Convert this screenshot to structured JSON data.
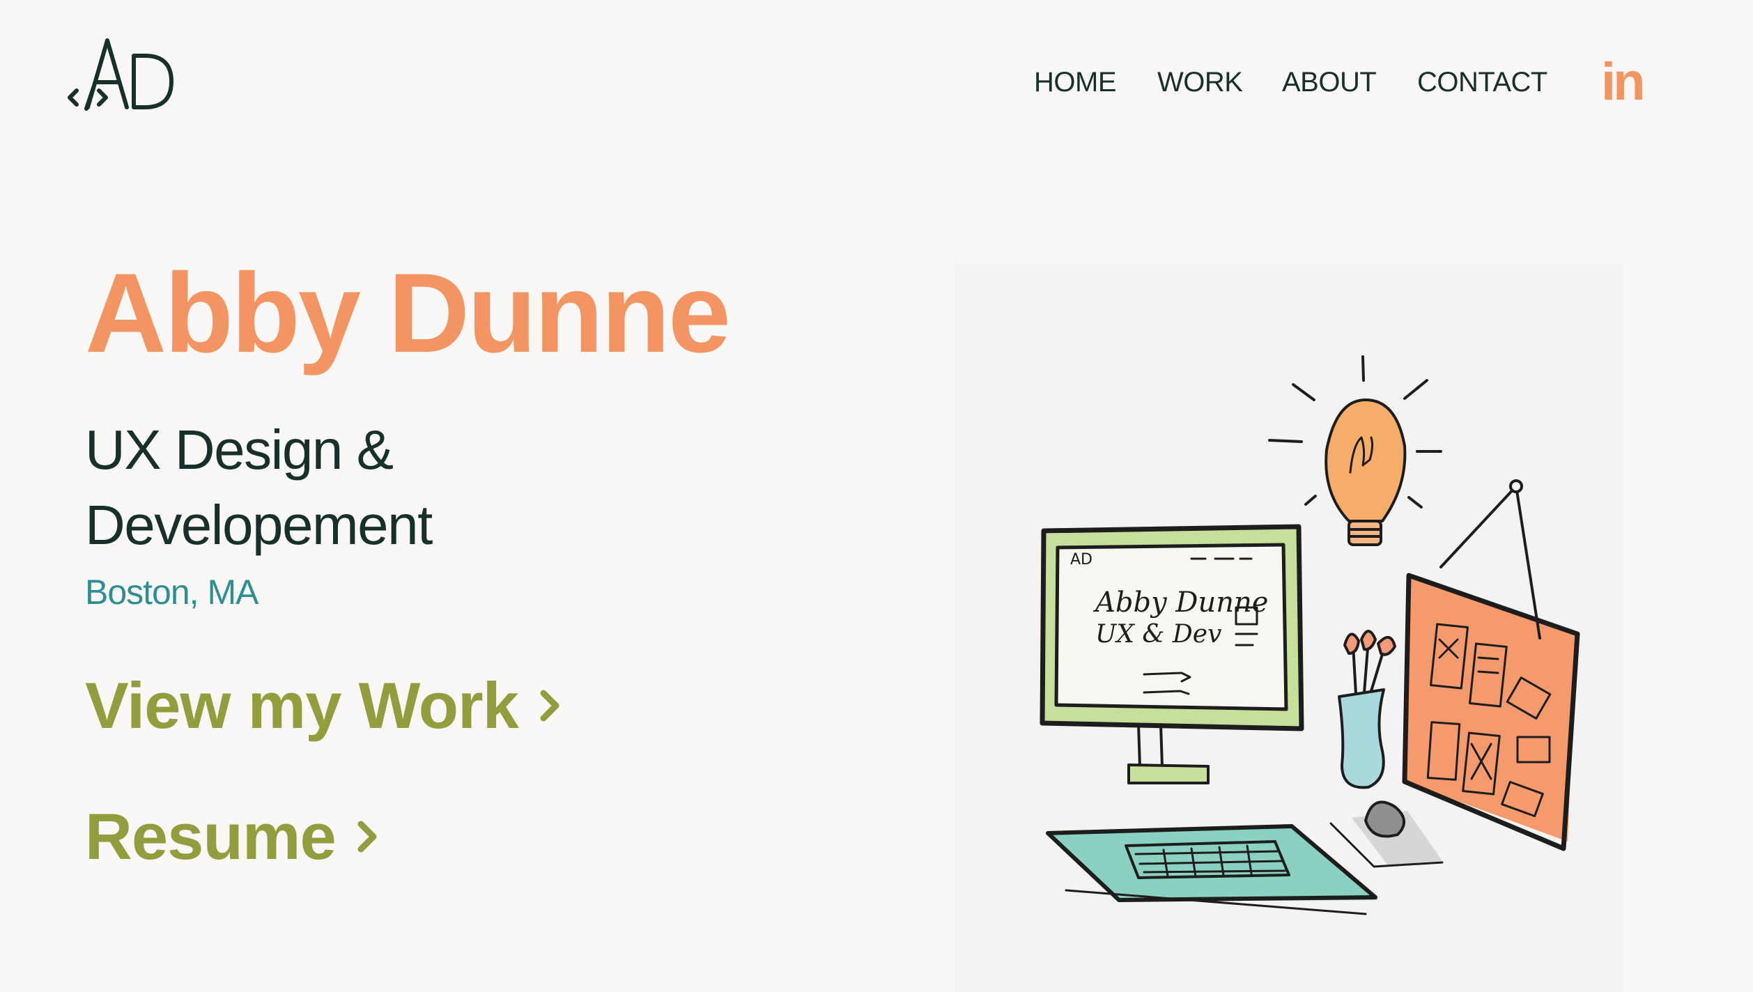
{
  "brand": {
    "logo_text": "AD",
    "logo_code_glyph": "</>"
  },
  "nav": {
    "items": [
      {
        "label": "HOME"
      },
      {
        "label": "WORK"
      },
      {
        "label": "ABOUT"
      },
      {
        "label": "CONTACT"
      }
    ],
    "social_label": "in"
  },
  "hero": {
    "name": "Abby Dunne",
    "role_line1": "UX Design &",
    "role_line2": "Developement",
    "location": "Boston, MA",
    "cta_work": "View my Work",
    "cta_resume": "Resume"
  },
  "illustration": {
    "screen_line1": "Abby Dunne",
    "screen_line2": "UX & Dev",
    "screen_logo": "AD"
  },
  "colors": {
    "background": "#faf8f6",
    "accent_orange": "#f29562",
    "text_dark": "#17302b",
    "teal": "#2e8f93",
    "olive": "#929e3d"
  },
  "icons": {
    "linkedin": "linkedin-icon",
    "chevron": "chevron-right-icon",
    "logo": "ad-logo-icon"
  }
}
